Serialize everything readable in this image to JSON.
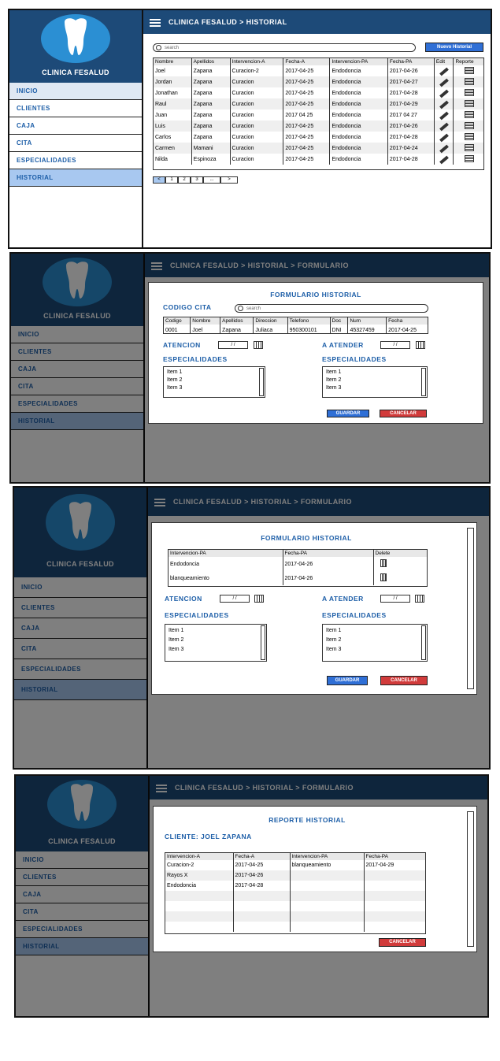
{
  "app": {
    "name": "CLINICA FESALUD"
  },
  "nav": [
    "INICIO",
    "CLIENTES",
    "CAJA",
    "CITA",
    "ESPECIALIDADES",
    "HISTORIAL"
  ],
  "screen1": {
    "breadcrumb": "CLINICA FESALUD  >  HISTORIAL",
    "search_placeholder": "search",
    "new_button": "Nuevo Historial",
    "columns": [
      "Nombre",
      "Apellidos",
      "Intervencion-A",
      "Fecha-A",
      "Intervencion-PA",
      "Fecha-PA",
      "Edit",
      "Reporte"
    ],
    "rows": [
      [
        "Joel",
        "Zapana",
        "Curacion-2",
        "2017-04-25",
        "Endodoncia",
        "2017-04-26"
      ],
      [
        "Jordan",
        "Zapana",
        "Curacion",
        "2017-04-25",
        "Endodoncia",
        "2017-04-27"
      ],
      [
        "Jonathan",
        "Zapana",
        "Curacion",
        "2017-04-25",
        "Endodoncia",
        "2017-04-28"
      ],
      [
        "Raul",
        "Zapana",
        "Curacion",
        "2017-04-25",
        "Endodoncia",
        "2017-04-29"
      ],
      [
        "Juan",
        "Zapana",
        "Curacion",
        "2017 04 25",
        "Endodoncia",
        "2017 04 27"
      ],
      [
        "Luis",
        "Zapana",
        "Curacion",
        "2017-04-25",
        "Endodoncia",
        "2017-04-26"
      ],
      [
        "Carlos",
        "Zapana",
        "Curacion",
        "2017-04-25",
        "Endodoncia",
        "2017-04-28"
      ],
      [
        "Carmen",
        "Mamani",
        "Curacion",
        "2017-04-25",
        "Endodoncia",
        "2017-04-24"
      ],
      [
        "Nilda",
        "Espinoza",
        "Curacion",
        "2017-04-25",
        "Endodoncia",
        "2017-04-28"
      ]
    ],
    "pager": [
      "<",
      "1",
      "2",
      "3",
      "...",
      ">"
    ]
  },
  "form_breadcrumb": "CLINICA FESALUD  >  HISTORIAL  >  FORMULARIO",
  "screen2": {
    "title": "FORMULARIO HISTORIAL",
    "codigo_label": "CODIGO CITA",
    "search_placeholder": "search",
    "columns": [
      "Codigo",
      "Nombre",
      "Apellidos",
      "Direccion",
      "Telefono",
      "Doc",
      "Num",
      "Fecha"
    ],
    "row": [
      "0001",
      "Joel",
      "Zapana",
      "Juliaca",
      "950300101",
      "DNI",
      "45327459",
      "2017-04-25"
    ]
  },
  "screen3": {
    "title": "FORMULARIO HISTORIAL",
    "columns": [
      "Intervencion-PA",
      "Fecha-PA",
      "Delete"
    ],
    "rows": [
      [
        "Endodoncia",
        "2017-04-26"
      ],
      [
        "blanqueamiento",
        "2017-04-26"
      ]
    ]
  },
  "common_form": {
    "atencion": "ATENCION",
    "a_atender": "A ATENDER",
    "date_placeholder": "/ /",
    "especialidades": "ESPECIALIDADES",
    "items": [
      "Item 1",
      "Item 2",
      "Item 3"
    ],
    "guardar": "GUARDAR",
    "cancelar": "CANCELAR"
  },
  "screen4": {
    "title": "REPORTE HISTORIAL",
    "cliente": "CLIENTE: JOEL ZAPANA",
    "columns": [
      "Intervencion-A",
      "Fecha-A",
      "Intervencion-PA",
      "Fecha-PA"
    ],
    "rows": [
      [
        "Curacion-2",
        "2017-04-25",
        "blanqueamiento",
        "2017-04-29"
      ],
      [
        "Rayos X",
        "2017-04-26",
        "",
        ""
      ],
      [
        "Endodoncia",
        "2017-04-28",
        "",
        ""
      ],
      [
        "",
        "",
        "",
        ""
      ],
      [
        "",
        "",
        "",
        ""
      ],
      [
        "",
        "",
        "",
        ""
      ],
      [
        "",
        "",
        "",
        ""
      ]
    ],
    "cancelar": "CANCELAR"
  },
  "colors": {
    "header": "#1d4a78",
    "accent": "#1e5fa8",
    "active": "#a8c8f0",
    "save": "#2f6fd6",
    "cancel": "#d13b3b"
  },
  "icons": [
    "menu-icon",
    "tooth-logo-icon",
    "search-icon",
    "edit-icon",
    "report-icon",
    "calendar-icon",
    "trash-icon"
  ]
}
